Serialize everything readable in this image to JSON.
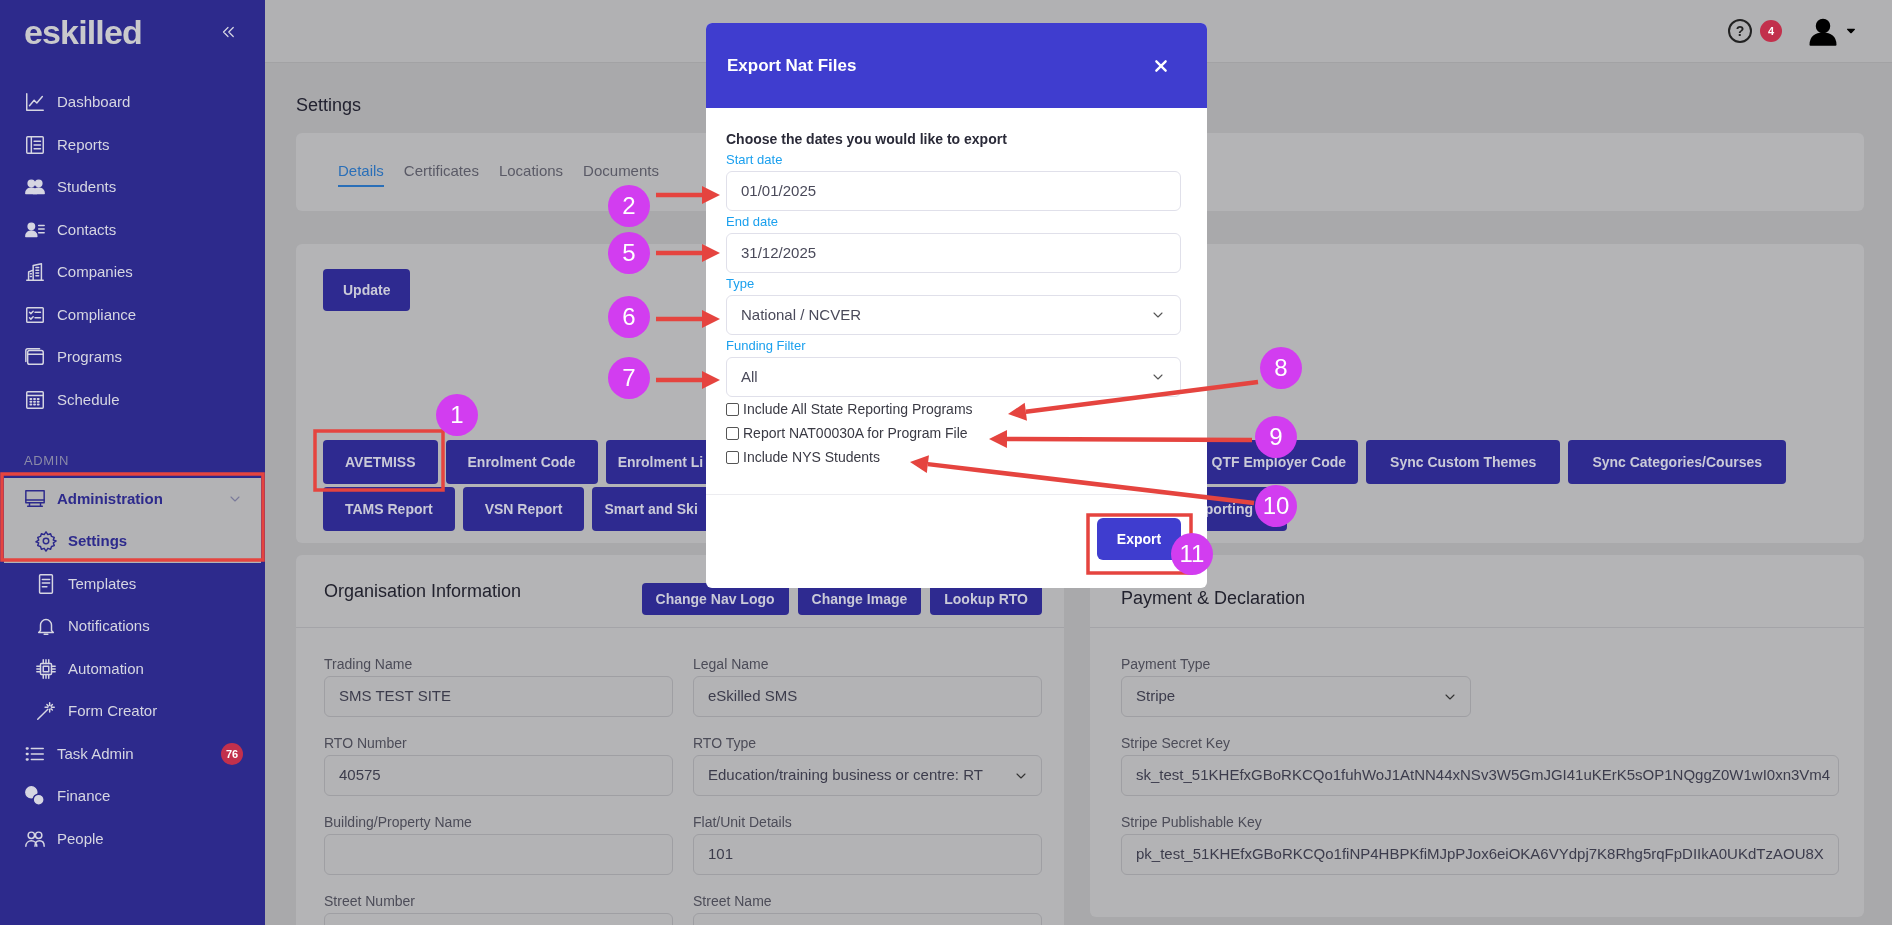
{
  "sidebar": {
    "logo": "eskilled",
    "sections": [
      {
        "items": [
          {
            "label": "Dashboard",
            "selected": false
          },
          {
            "label": "Reports",
            "selected": false
          },
          {
            "label": "Students",
            "selected": false
          },
          {
            "label": "Contacts",
            "selected": false
          },
          {
            "label": "Companies",
            "selected": false
          },
          {
            "label": "Compliance",
            "selected": false
          },
          {
            "label": "Programs",
            "selected": false
          },
          {
            "label": "Schedule",
            "selected": false
          }
        ]
      },
      {
        "title": "ADMIN",
        "items": [
          {
            "label": "Administration",
            "selected": true,
            "expanded": true,
            "children": [
              {
                "label": "Settings",
                "selected": true
              },
              {
                "label": "Templates",
                "selected": false
              },
              {
                "label": "Notifications",
                "selected": false
              },
              {
                "label": "Automation",
                "selected": false
              },
              {
                "label": "Form Creator",
                "selected": false
              }
            ]
          },
          {
            "label": "Task Admin",
            "selected": false,
            "badge": "76"
          },
          {
            "label": "Finance",
            "selected": false
          },
          {
            "label": "People",
            "selected": false
          }
        ]
      }
    ]
  },
  "topbar": {
    "help": "?",
    "notification_count": "4"
  },
  "page_title": "Settings",
  "tabs": [
    {
      "label": "Details",
      "selected": true
    },
    {
      "label": "Certificates",
      "selected": false
    },
    {
      "label": "Locations",
      "selected": false
    },
    {
      "label": "Documents",
      "selected": false
    }
  ],
  "settings_card": {
    "update_button": "Update",
    "button_rows": [
      {
        "left": [
          "AVETMISS",
          "Enrolment Code",
          "Enrolment Li"
        ],
        "right": [
          "QTF Employer Code",
          "Sync Custom Themes",
          "Sync Categories/Courses"
        ]
      },
      {
        "left": [
          "TAMS Report",
          "VSN Report",
          "Smart and Ski"
        ],
        "right": [
          "porting"
        ]
      }
    ]
  },
  "organisation": {
    "title": "Organisation Information",
    "buttons": [
      "Change Nav Logo",
      "Change Image",
      "Lookup RTO"
    ],
    "fields": [
      {
        "label": "Trading Name",
        "value": "SMS TEST SITE",
        "kind": "text"
      },
      {
        "label": "Legal Name",
        "value": "eSkilled SMS",
        "kind": "text"
      },
      {
        "label": "RTO Number",
        "value": "40575",
        "kind": "text"
      },
      {
        "label": "RTO Type",
        "value": "Education/training business or centre: RT",
        "kind": "select"
      },
      {
        "label": "Building/Property Name",
        "kind": "text"
      },
      {
        "label": "Flat/Unit Details",
        "value": "101",
        "kind": "text"
      },
      {
        "label": "Street Number",
        "kind": "text"
      },
      {
        "label": "Street Name",
        "kind": "text"
      }
    ]
  },
  "payment": {
    "title": "Payment & Declaration",
    "fields": [
      {
        "label": "Payment Type",
        "value": "Stripe",
        "kind": "select"
      },
      {
        "label": "Stripe Secret Key",
        "value": "sk_test_51KHEfxGBoRKCQo1fuhWoJ1AtNN44xNSv3W5GmJGI41uKErK5sOP1NQggZ0W1wI0xn3Vm4",
        "kind": "text"
      },
      {
        "label": "Stripe Publishable Key",
        "value": "pk_test_51KHEfxGBoRKCQo1fiNP4HBPKfiMJpPJox6eiOKA6VYdpj7K8Rhg5rqFpDIIkA0UKdTzAOU8X",
        "kind": "text"
      }
    ]
  },
  "modal": {
    "title": "Export Nat Files",
    "intro": "Choose the dates you would like to export",
    "fields": [
      {
        "label": "Start date",
        "value": "01/01/2025",
        "kind": "date"
      },
      {
        "label": "End date",
        "value": "31/12/2025",
        "kind": "date"
      },
      {
        "label": "Type",
        "value": "National / NCVER",
        "kind": "select"
      },
      {
        "label": "Funding Filter",
        "value": "All",
        "kind": "select"
      }
    ],
    "checkboxes": [
      {
        "label": "Include All State Reporting Programs",
        "checked": false
      },
      {
        "label": "Report NAT00030A for Program File",
        "checked": false
      },
      {
        "label": "Include NYS Students",
        "checked": false
      }
    ],
    "export_button": "Export"
  },
  "annotations": [
    "1",
    "2",
    "5",
    "6",
    "7",
    "8",
    "9",
    "10",
    "11"
  ]
}
